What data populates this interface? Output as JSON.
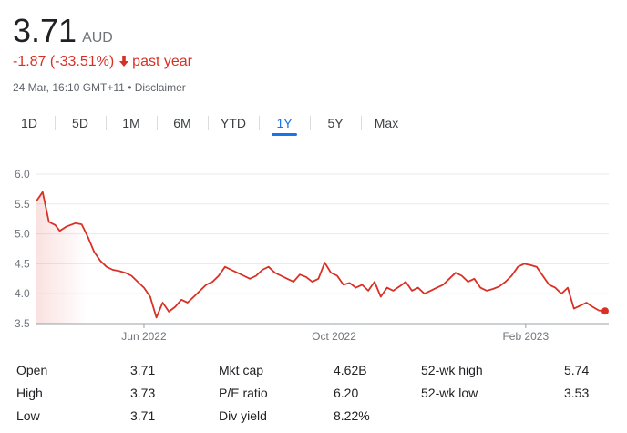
{
  "quote": {
    "price": "3.71",
    "currency": "AUD",
    "change": "-1.87 (-33.51%)",
    "period": "past year",
    "timestamp": "24 Mar, 16:10 GMT+11",
    "separator": "•",
    "disclaimer": "Disclaimer"
  },
  "colors": {
    "line": "#d93025",
    "active_tab": "#1a73e8",
    "grid": "#e8eaed"
  },
  "tabs": [
    {
      "label": "1D"
    },
    {
      "label": "5D"
    },
    {
      "label": "1M"
    },
    {
      "label": "6M"
    },
    {
      "label": "YTD"
    },
    {
      "label": "1Y",
      "active": true
    },
    {
      "label": "5Y"
    },
    {
      "label": "Max"
    }
  ],
  "chart_data": {
    "type": "line",
    "ylim": [
      3.5,
      6.0
    ],
    "yticks": [
      "6.0",
      "5.5",
      "5.0",
      "4.5",
      "4.0",
      "3.5"
    ],
    "xticks": [
      {
        "label": "Jun 2022",
        "date": "2022-06-01"
      },
      {
        "label": "Oct 2022",
        "date": "2022-10-01"
      },
      {
        "label": "Feb 2023",
        "date": "2023-02-01"
      }
    ],
    "x": [
      "2022-03-24",
      "2022-03-28",
      "2022-04-01",
      "2022-04-05",
      "2022-04-08",
      "2022-04-12",
      "2022-04-18",
      "2022-04-22",
      "2022-04-26",
      "2022-04-30",
      "2022-05-04",
      "2022-05-08",
      "2022-05-12",
      "2022-05-16",
      "2022-05-20",
      "2022-05-24",
      "2022-05-28",
      "2022-06-01",
      "2022-06-05",
      "2022-06-09",
      "2022-06-13",
      "2022-06-17",
      "2022-06-21",
      "2022-06-25",
      "2022-06-29",
      "2022-07-03",
      "2022-07-07",
      "2022-07-11",
      "2022-07-15",
      "2022-07-19",
      "2022-07-23",
      "2022-07-27",
      "2022-07-31",
      "2022-08-04",
      "2022-08-08",
      "2022-08-12",
      "2022-08-16",
      "2022-08-20",
      "2022-08-24",
      "2022-08-28",
      "2022-09-01",
      "2022-09-05",
      "2022-09-09",
      "2022-09-13",
      "2022-09-17",
      "2022-09-21",
      "2022-09-25",
      "2022-09-29",
      "2022-10-03",
      "2022-10-07",
      "2022-10-11",
      "2022-10-15",
      "2022-10-19",
      "2022-10-23",
      "2022-10-27",
      "2022-10-31",
      "2022-11-04",
      "2022-11-08",
      "2022-11-12",
      "2022-11-16",
      "2022-11-20",
      "2022-11-24",
      "2022-11-28",
      "2022-12-02",
      "2022-12-06",
      "2022-12-10",
      "2022-12-14",
      "2022-12-18",
      "2022-12-22",
      "2022-12-26",
      "2022-12-30",
      "2023-01-03",
      "2023-01-07",
      "2023-01-11",
      "2023-01-15",
      "2023-01-19",
      "2023-01-23",
      "2023-01-27",
      "2023-01-31",
      "2023-02-04",
      "2023-02-08",
      "2023-02-12",
      "2023-02-16",
      "2023-02-20",
      "2023-02-24",
      "2023-02-28",
      "2023-03-04",
      "2023-03-08",
      "2023-03-12",
      "2023-03-16",
      "2023-03-20",
      "2023-03-24"
    ],
    "values": [
      5.55,
      5.7,
      5.2,
      5.15,
      5.05,
      5.12,
      5.18,
      5.16,
      4.95,
      4.7,
      4.55,
      4.45,
      4.4,
      4.38,
      4.35,
      4.3,
      4.2,
      4.1,
      3.95,
      3.6,
      3.85,
      3.7,
      3.78,
      3.9,
      3.85,
      3.95,
      4.05,
      4.15,
      4.2,
      4.3,
      4.45,
      4.4,
      4.35,
      4.3,
      4.25,
      4.3,
      4.4,
      4.45,
      4.35,
      4.3,
      4.25,
      4.2,
      4.32,
      4.28,
      4.2,
      4.25,
      4.52,
      4.35,
      4.3,
      4.15,
      4.18,
      4.1,
      4.15,
      4.05,
      4.2,
      3.95,
      4.1,
      4.05,
      4.12,
      4.2,
      4.05,
      4.1,
      4.0,
      4.05,
      4.1,
      4.15,
      4.25,
      4.35,
      4.3,
      4.2,
      4.25,
      4.1,
      4.05,
      4.08,
      4.12,
      4.2,
      4.3,
      4.45,
      4.5,
      4.48,
      4.45,
      4.3,
      4.15,
      4.1,
      4.0,
      4.1,
      3.75,
      3.8,
      3.85,
      3.78,
      3.72,
      3.71
    ]
  },
  "stats": [
    [
      {
        "label": "Open",
        "value": "3.71"
      },
      {
        "label": "Mkt cap",
        "value": "4.62B"
      },
      {
        "label": "52-wk high",
        "value": "5.74"
      }
    ],
    [
      {
        "label": "High",
        "value": "3.73"
      },
      {
        "label": "P/E ratio",
        "value": "6.20"
      },
      {
        "label": "52-wk low",
        "value": "3.53"
      }
    ],
    [
      {
        "label": "Low",
        "value": "3.71"
      },
      {
        "label": "Div yield",
        "value": "8.22%"
      },
      {
        "label": "",
        "value": ""
      }
    ]
  ]
}
